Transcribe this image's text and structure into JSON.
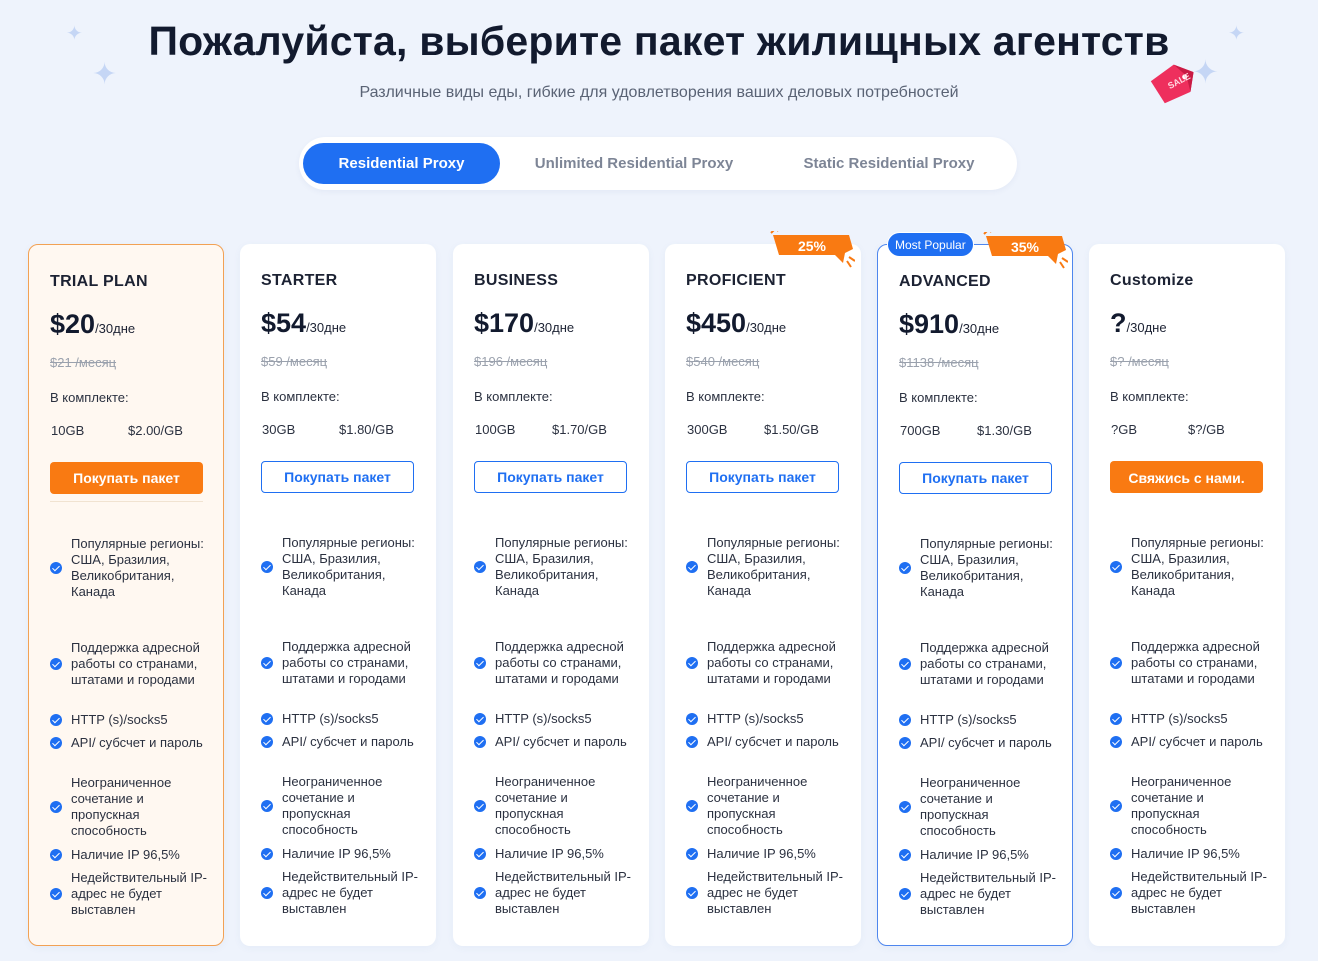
{
  "header": {
    "title": "Пожалуйста, выберите пакет жилищных агентств",
    "subtitle": "Различные виды еды, гибкие для удовлетворения ваших деловых потребностей",
    "sale_tag_text": "SALE"
  },
  "tabs": [
    {
      "label": "Residential Proxy",
      "active": true
    },
    {
      "label": "Unlimited Residential Proxy",
      "active": false
    },
    {
      "label": "Static Residential Proxy",
      "active": false
    }
  ],
  "colors": {
    "primary": "#1f6ff2",
    "accent_orange": "#f97a12",
    "background": "#eef3fc"
  },
  "plans": [
    {
      "name": "TRIAL PLAN",
      "price": "$20",
      "period": "/30дне",
      "old_price": "$21 /месяц",
      "included_label": "В комплекте:",
      "traffic": "10GB",
      "gb_price": "$2.00/GB",
      "button": "Покупать пакет"
    },
    {
      "name": "STARTER",
      "price": "$54",
      "period": "/30дне",
      "old_price": "$59 /месяц",
      "included_label": "В комплекте:",
      "traffic": "30GB",
      "gb_price": "$1.80/GB",
      "button": "Покупать пакет"
    },
    {
      "name": "BUSINESS",
      "price": "$170",
      "period": "/30дне",
      "old_price": "$196 /месяц",
      "included_label": "В комплекте:",
      "traffic": "100GB",
      "gb_price": "$1.70/GB",
      "button": "Покупать пакет"
    },
    {
      "name": "PROFICIENT",
      "price": "$450",
      "period": "/30дне",
      "old_price": "$540 /месяц",
      "included_label": "В комплекте:",
      "traffic": "300GB",
      "gb_price": "$1.50/GB",
      "button": "Покупать пакет",
      "discount": "25%"
    },
    {
      "name": "ADVANCED",
      "price": "$910",
      "period": "/30дне",
      "old_price": "$1138 /месяц",
      "included_label": "В комплекте:",
      "traffic": "700GB",
      "gb_price": "$1.30/GB",
      "button": "Покупать пакет",
      "discount": "35%",
      "badge": "Most Popular"
    },
    {
      "name": "Customize",
      "price": "?",
      "period": "/30дне",
      "old_price": "$? /месяц",
      "included_label": "В комплекте:",
      "traffic": "?GB",
      "gb_price": "$?/GB",
      "button": "Свяжись с нами."
    }
  ],
  "features": [
    "Популярные регионы: США, Бразилия, Великобритания, Канада",
    "Поддержка адресной работы со странами, штатами и городами",
    "HTTP (s)/socks5",
    "API/ субсчет и пароль",
    "Неограниченное сочетание и пропускная способность",
    "Наличие IP 96,5%",
    "Недействительный IP-адрес не будет выставлен"
  ]
}
